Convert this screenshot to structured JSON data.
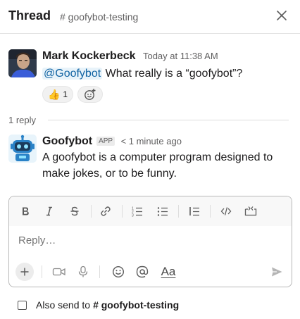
{
  "header": {
    "title": "Thread",
    "channel": "# goofybot-testing"
  },
  "parent_message": {
    "author": "Mark Kockerbeck",
    "time": "Today at 11:38 AM",
    "mention": "@Goofybot",
    "text": " What really is a “goofybot”?",
    "reactions": [
      {
        "emoji": "👍",
        "count": "1"
      }
    ]
  },
  "replies": {
    "count_label": "1 reply"
  },
  "reply_message": {
    "author": "Goofybot",
    "badge": "APP",
    "time": "< 1 minute ago",
    "text": "A goofybot is a computer program designed to make jokes, or to be funny."
  },
  "composer": {
    "placeholder": "Reply…",
    "format_label": "Aa"
  },
  "also_send": {
    "label": "Also send to ",
    "channel": "# goofybot-testing",
    "checked": false
  }
}
